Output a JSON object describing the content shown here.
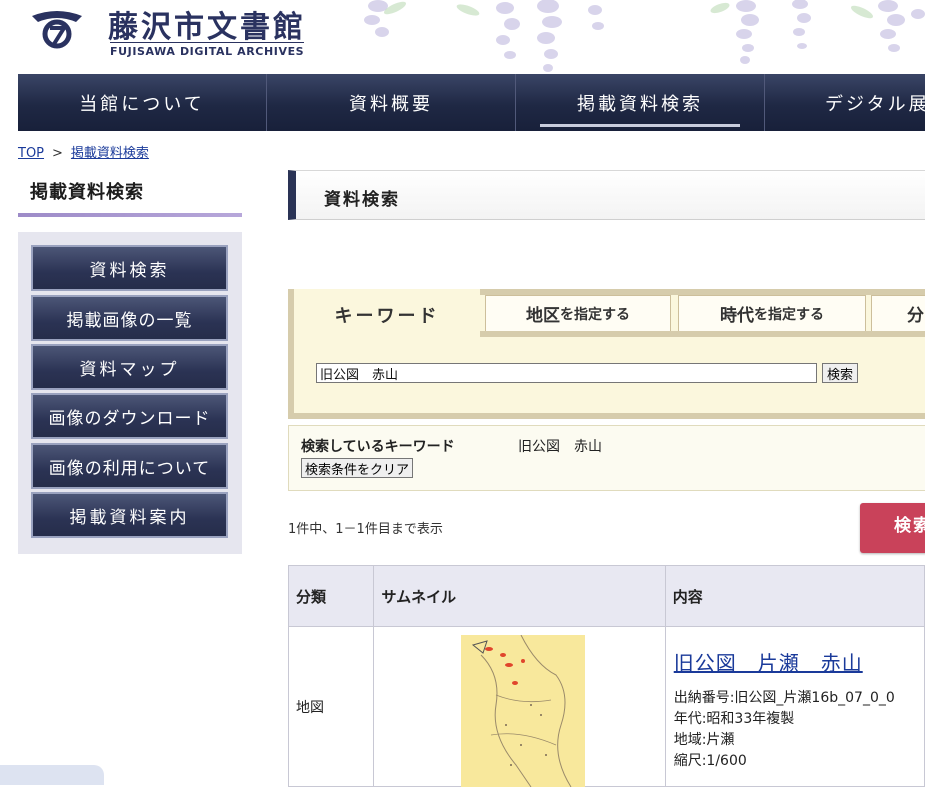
{
  "site": {
    "title": "藤沢市文書館",
    "subtitle": "FUJISAWA DIGITAL ARCHIVES"
  },
  "nav": [
    "当館について",
    "資料概要",
    "掲載資料検索",
    "デジタル展"
  ],
  "breadcrumb": {
    "home": "TOP",
    "separator": ">",
    "current": "掲載資料検索"
  },
  "sidebar": {
    "title": "掲載資料検索",
    "items": [
      "資料検索",
      "掲載画像の一覧",
      "資料マップ",
      "画像のダウンロード",
      "画像の利用について",
      "掲載資料案内"
    ]
  },
  "section": {
    "heading": "資料検索"
  },
  "search": {
    "tabs": [
      {
        "main": "キーワード",
        "suffix": ""
      },
      {
        "main": "地区",
        "suffix": "を指定する"
      },
      {
        "main": "時代",
        "suffix": "を指定する"
      },
      {
        "main": "分",
        "suffix": ""
      }
    ],
    "keyword_value": "旧公図　赤山",
    "submit_label": "検索",
    "status_label": "検索しているキーワード",
    "status_value": "旧公図　赤山",
    "clear_label": "検索条件をクリア"
  },
  "results": {
    "count_text": "1件中、1－1件目まで表示",
    "side_button": "検索",
    "headers": [
      "分類",
      "サムネイル",
      "内容"
    ],
    "rows": [
      {
        "category": "地図",
        "title": "旧公図　片瀬　赤山",
        "meta": [
          "出納番号:旧公図_片瀬16b_07_0_0",
          "年代:昭和33年複製",
          "地域:片瀬",
          "縮尺:1/600"
        ]
      }
    ]
  },
  "colors": {
    "nav_bg": "#1f2844",
    "brand_navy": "#2a3260",
    "search_bg": "#fbf7dd",
    "accent_red": "#c9425a",
    "link": "#1a3a9a",
    "sidebar_accent": "#9d8bc8"
  }
}
